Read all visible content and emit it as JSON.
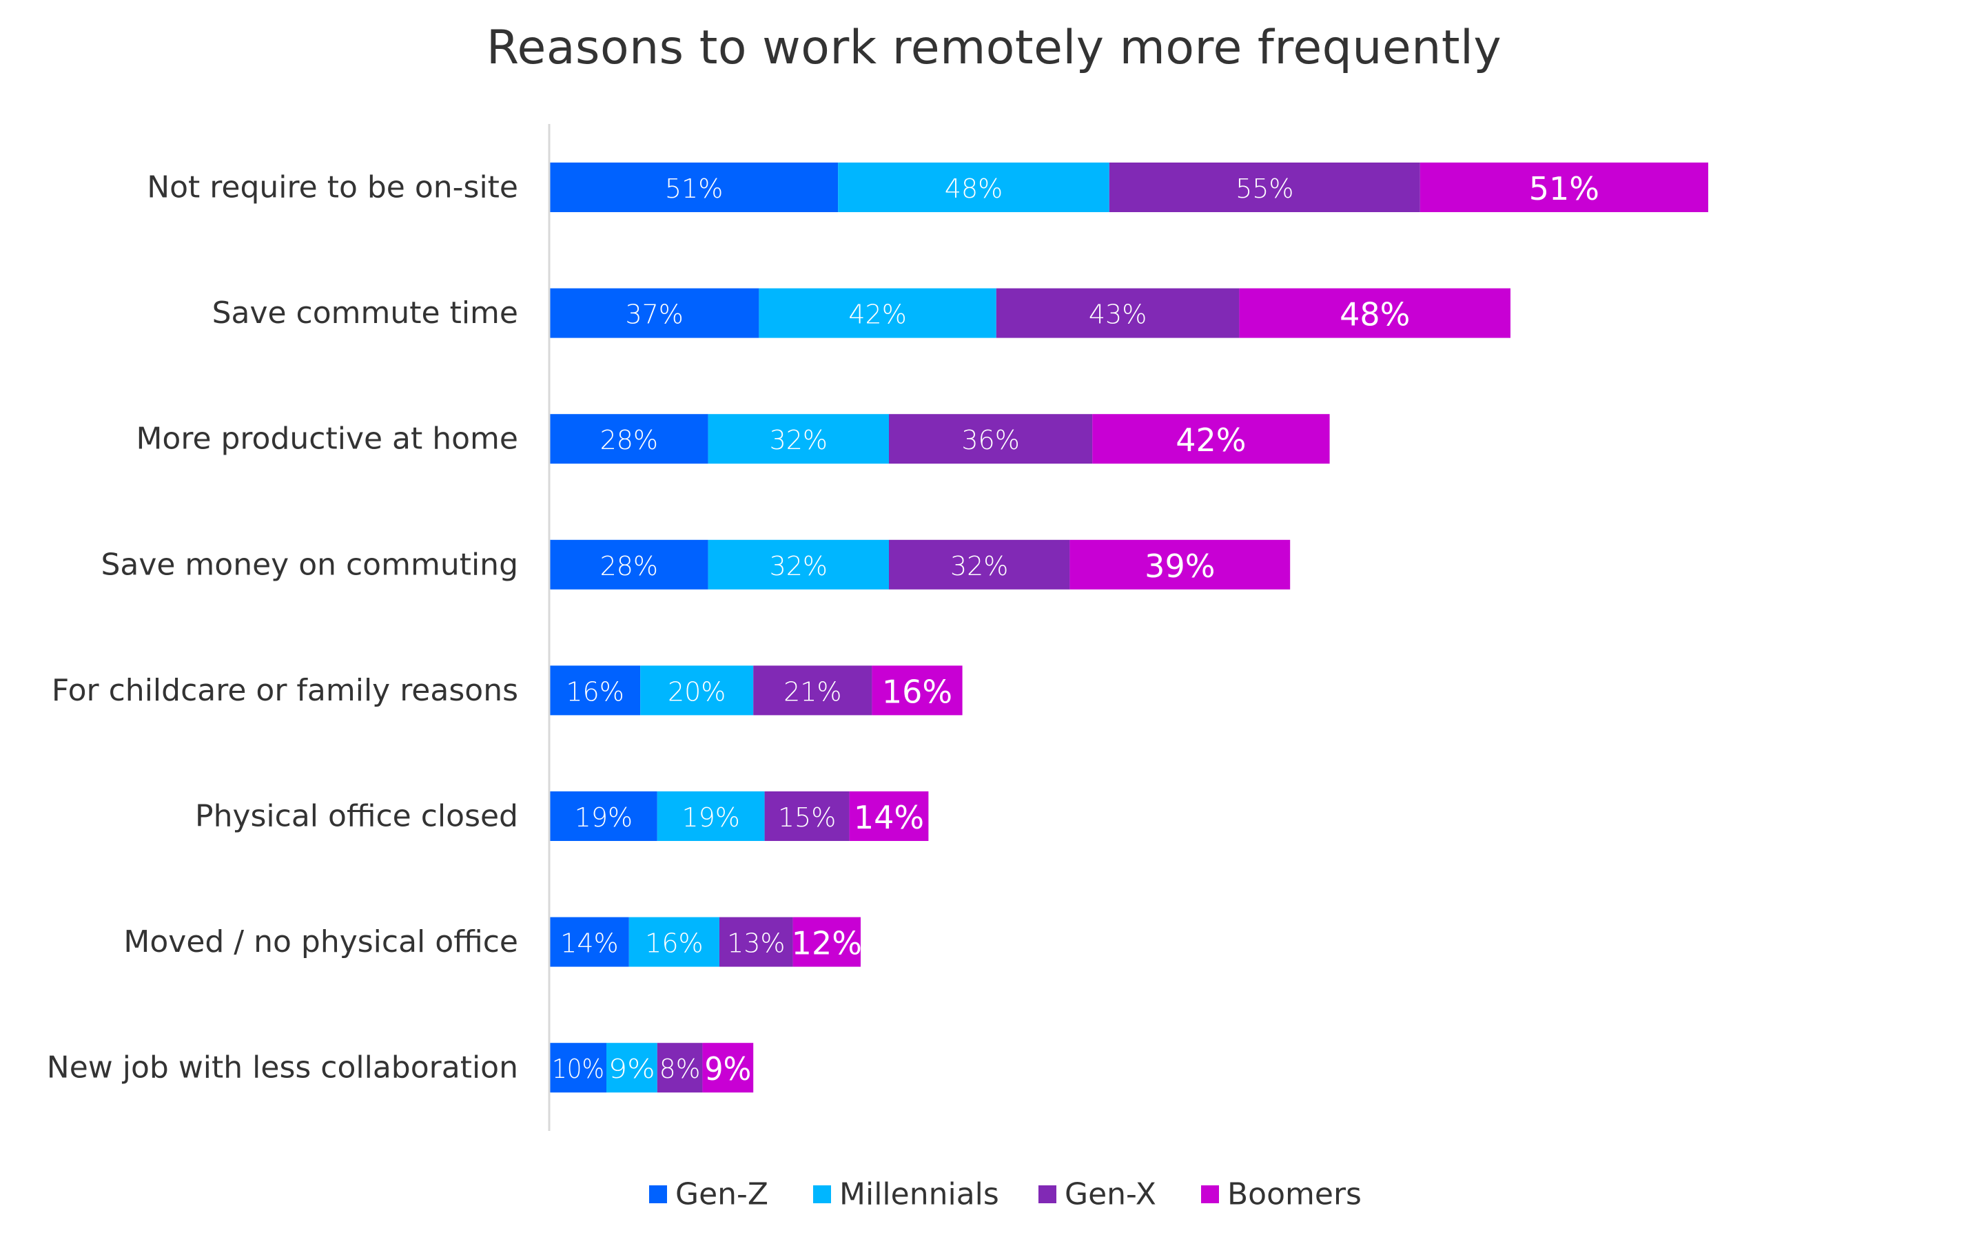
{
  "chart_data": {
    "type": "bar",
    "orientation": "horizontal",
    "stacked": true,
    "title": "Reasons to work remotely more frequently",
    "xlabel": "",
    "ylabel": "",
    "grid": false,
    "legend_position": "bottom",
    "categories": [
      "Not require to be on-site",
      "Save commute time",
      "More productive at home",
      "Save money on commuting",
      "For childcare or family reasons",
      "Physical office closed",
      "Moved / no physical office",
      "New job with less collaboration"
    ],
    "series": [
      {
        "name": "Gen-Z",
        "color": "#0062FF",
        "values": [
          51,
          37,
          28,
          28,
          16,
          19,
          14,
          10
        ]
      },
      {
        "name": "Millennials",
        "color": "#00B6FF",
        "values": [
          48,
          42,
          32,
          32,
          20,
          19,
          16,
          9
        ]
      },
      {
        "name": "Gen-X",
        "color": "#8129B5",
        "values": [
          55,
          43,
          36,
          32,
          21,
          15,
          13,
          8
        ]
      },
      {
        "name": "Boomers",
        "color": "#C800D4",
        "values": [
          51,
          48,
          42,
          39,
          16,
          14,
          12,
          9
        ]
      }
    ],
    "value_suffix": "%"
  },
  "colors": {
    "text": "#333333",
    "axis_line": "#D9D9D9",
    "data_label": "#FFFFFF"
  }
}
